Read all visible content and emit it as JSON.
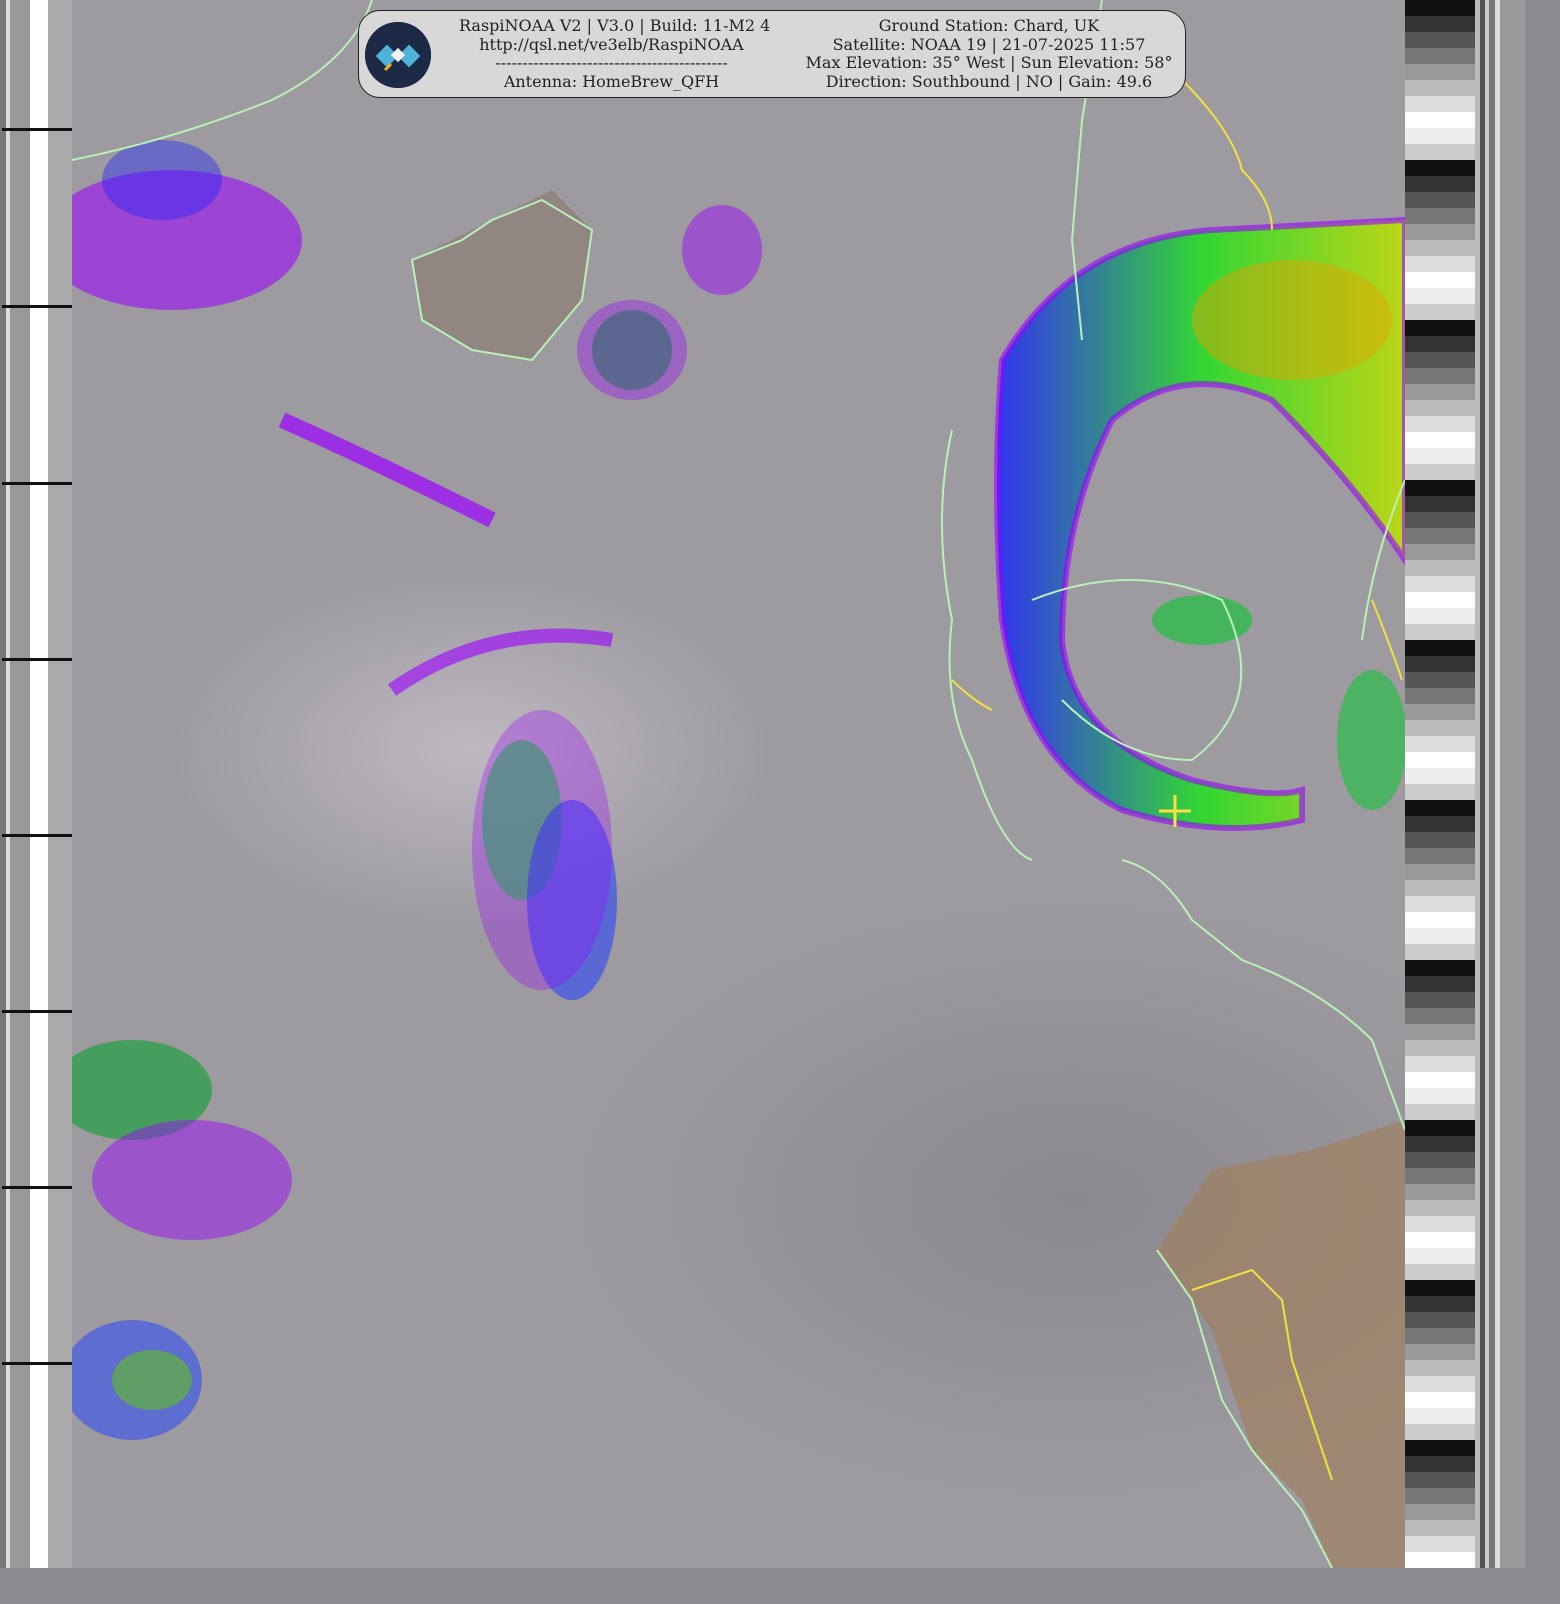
{
  "info_box": {
    "left": {
      "line1": "RaspiNOAA V2 | V3.0 | Build: 11-M2 4",
      "line2": "http://qsl.net/ve3elb/RaspiNOAA",
      "line3": "-------------------------------------------",
      "line4": "Antenna: HomeBrew_QFH"
    },
    "right": {
      "line1": "Ground Station: Chard, UK",
      "line2": "Satellite: NOAA 19 | 21-07-2025 11:57",
      "line3": "Max Elevation: 35° West | Sun Elevation: 58°",
      "line4": "Direction: Southbound | NO | Gain: 49.6"
    }
  },
  "icons": {
    "logo": "satellite-icon",
    "marker": "crosshair-icon"
  },
  "colors": {
    "coastline": "#b8f0b8",
    "border": "#f0e040",
    "cloud_high": "#9b00ff",
    "cloud_cold": "#2020ff",
    "cloud_colder": "#20e020",
    "cloud_coldest": "#ff2000",
    "land_warm": "#b08050"
  }
}
